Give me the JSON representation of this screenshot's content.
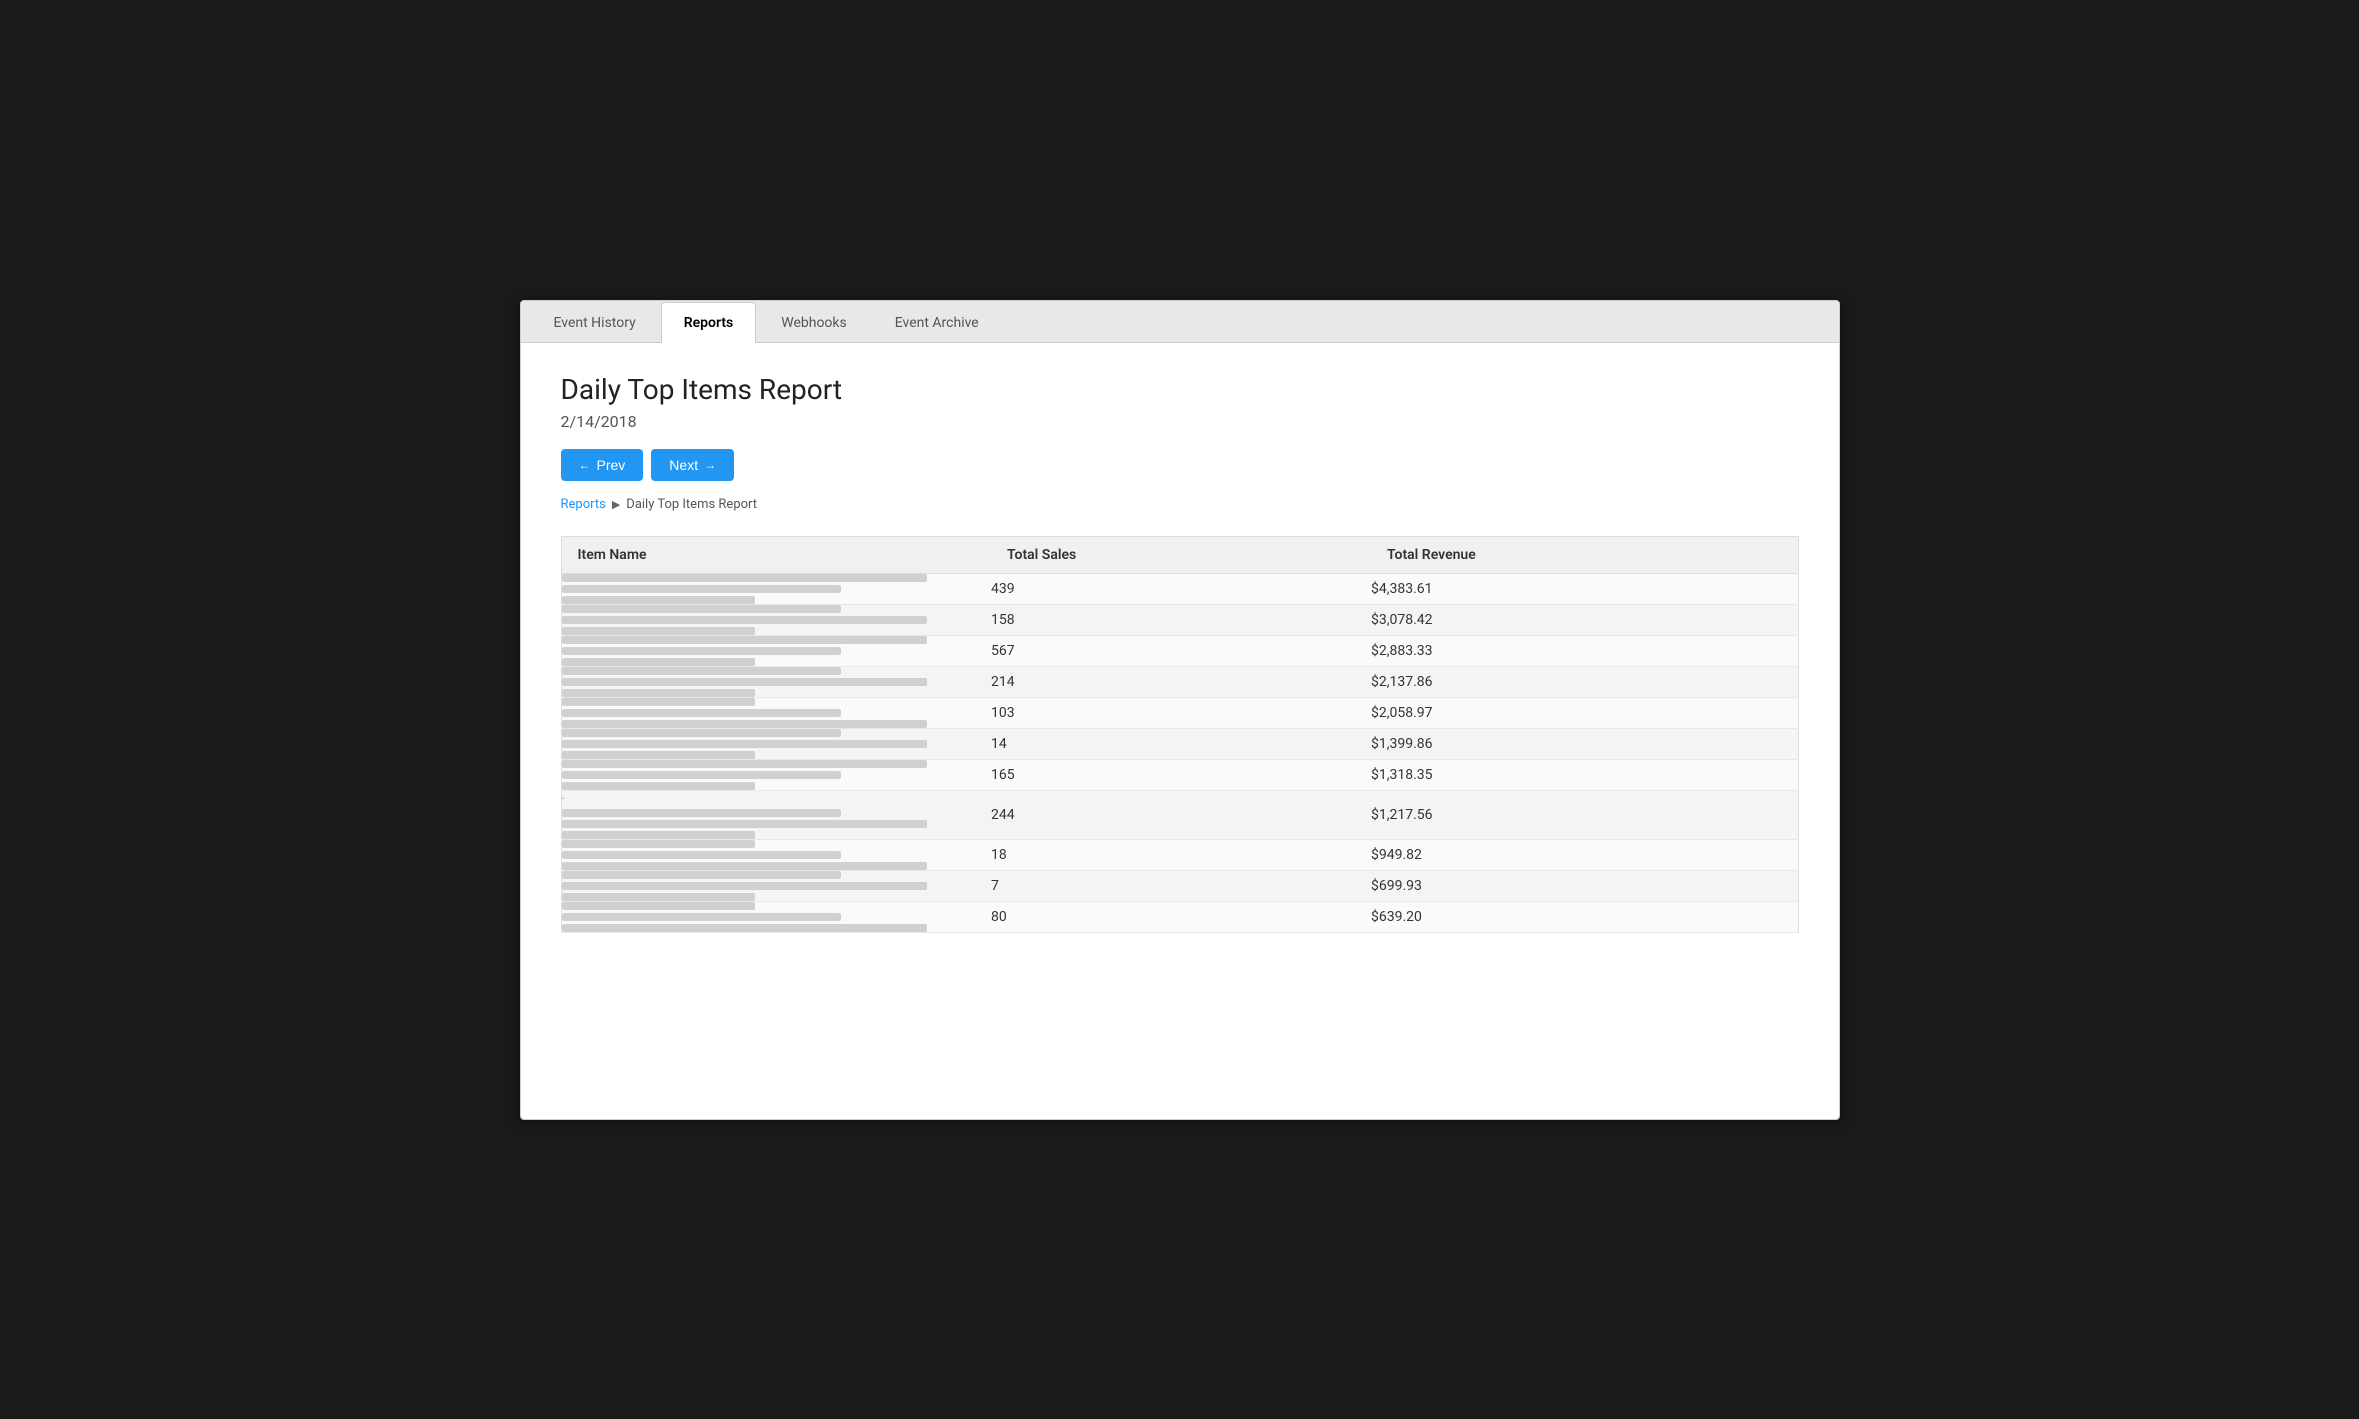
{
  "tabs": [
    {
      "id": "event-history",
      "label": "Event History",
      "active": false
    },
    {
      "id": "reports",
      "label": "Reports",
      "active": true
    },
    {
      "id": "webhooks",
      "label": "Webhooks",
      "active": false
    },
    {
      "id": "event-archive",
      "label": "Event Archive",
      "active": false
    }
  ],
  "page": {
    "title": "Daily Top Items Report",
    "date": "2/14/2018",
    "prev_label": "Prev",
    "next_label": "Next"
  },
  "breadcrumb": {
    "parent_label": "Reports",
    "separator": "▶",
    "current": "Daily Top Items Report"
  },
  "table": {
    "columns": [
      "Item Name",
      "Total Sales",
      "Total Revenue"
    ],
    "rows": [
      {
        "sales": "439",
        "revenue": "$4,383.61",
        "bar_pattern": "long"
      },
      {
        "sales": "158",
        "revenue": "$3,078.42",
        "bar_pattern": "medium"
      },
      {
        "sales": "567",
        "revenue": "$2,883.33",
        "bar_pattern": "long"
      },
      {
        "sales": "214",
        "revenue": "$2,137.86",
        "bar_pattern": "medium"
      },
      {
        "sales": "103",
        "revenue": "$2,058.97",
        "bar_pattern": "short"
      },
      {
        "sales": "14",
        "revenue": "$1,399.86",
        "bar_pattern": "medium"
      },
      {
        "sales": "165",
        "revenue": "$1,318.35",
        "bar_pattern": "long"
      },
      {
        "sales": "244",
        "revenue": "$1,217.56",
        "bar_pattern": "medium",
        "has_dot": true
      },
      {
        "sales": "18",
        "revenue": "$949.82",
        "bar_pattern": "short"
      },
      {
        "sales": "7",
        "revenue": "$699.93",
        "bar_pattern": "medium"
      },
      {
        "sales": "80",
        "revenue": "$639.20",
        "bar_pattern": "short"
      }
    ]
  }
}
